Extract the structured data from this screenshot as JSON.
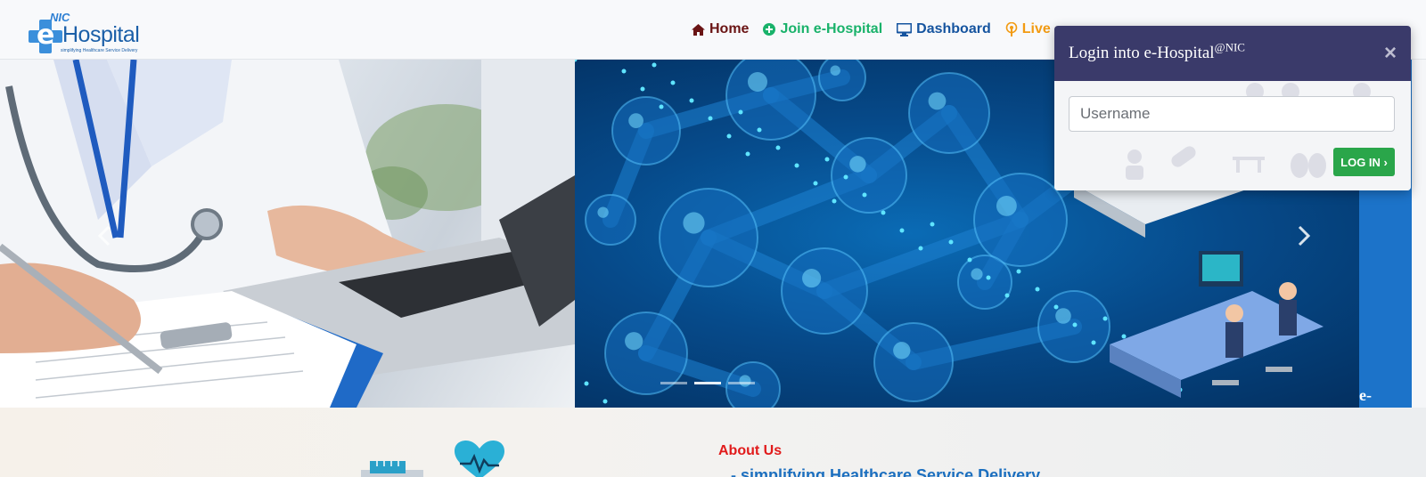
{
  "header": {
    "logo": {
      "nic": "NIC",
      "letter": "e",
      "name": "Hospital",
      "tagline": "simplifying Healthcare Service Delivery"
    },
    "nav": [
      {
        "label": "Home",
        "icon": "home-icon",
        "color": "#6a1414"
      },
      {
        "label": "Join e-Hospital",
        "icon": "plus-circle-icon",
        "color": "#19b26a"
      },
      {
        "label": "Dashboard",
        "icon": "monitor-icon",
        "color": "#15549f"
      },
      {
        "label": "Live",
        "icon": "broadcast-icon",
        "color": "#f29b12"
      }
    ]
  },
  "login": {
    "title": "Login into e-Hospital",
    "title_sup": "@NIC",
    "close_label": "×",
    "username_placeholder": "Username",
    "button_label": "LOG IN ›"
  },
  "carousel": {
    "slides": 3,
    "active_index": 1,
    "prev_icon": "chevron-left-icon",
    "next_icon": "chevron-right-icon"
  },
  "about": {
    "label": "About Us",
    "subtitle": "- simplifying Healthcare Service Delivery"
  },
  "colors": {
    "header_bg": "#f8f9fb",
    "login_header": "#3a3a6a",
    "login_button": "#2aa64a",
    "about_red": "#e11b1b",
    "brand_blue": "#1b5fa8"
  }
}
